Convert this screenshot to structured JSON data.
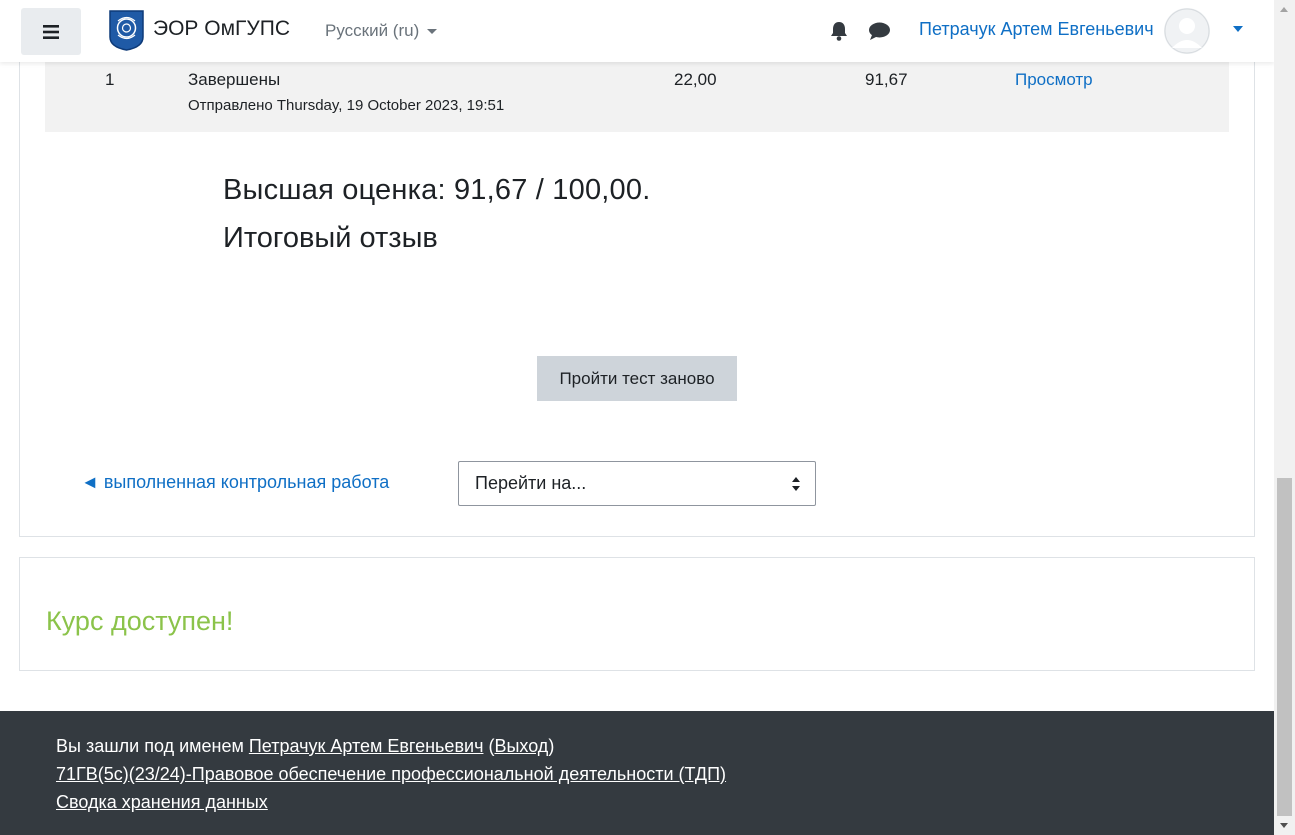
{
  "navbar": {
    "site_name": "ЭОР ОмГУПС",
    "language": "Русский (ru)",
    "user_name": "Петрачук Артем Евгеньевич"
  },
  "attempt": {
    "number": "1",
    "state": "Завершены",
    "submitted": "Отправлено Thursday, 19 October 2023, 19:51",
    "marks": "22,00",
    "grade": "91,67",
    "review_link": "Просмотр"
  },
  "summary": {
    "highest_grade": "Высшая оценка: 91,67 / 100,00.",
    "overall_feedback": "Итоговый отзыв"
  },
  "actions": {
    "retake_label": "Пройти тест заново",
    "prev_activity": "◄ выполненная контрольная работа",
    "jump_placeholder": "Перейти на..."
  },
  "notice": {
    "course_available": "Курс доступен!"
  },
  "footer": {
    "logged_in_prefix": "Вы зашли под именем ",
    "user_name": "Петрачук Артем Евгеньевич",
    "logout_open": " (",
    "logout": "Выход",
    "logout_close": ")",
    "course_link": "71ГВ(5с)(23/24)-Правовое обеспечение профессиональной деятельности (ТДП)",
    "data_retention": "Сводка хранения данных"
  },
  "colors": {
    "link": "#0f6fc5",
    "success": "#8bc34a",
    "footer_bg": "#343a40"
  }
}
